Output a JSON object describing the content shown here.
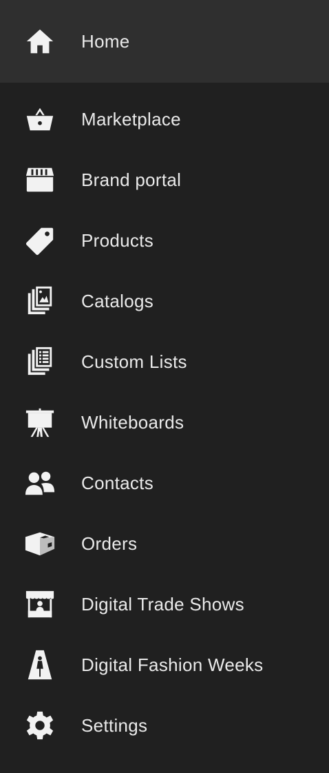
{
  "nav": {
    "items": [
      {
        "label": "Home",
        "icon": "home-icon",
        "active": true
      },
      {
        "label": "Marketplace",
        "icon": "basket-icon"
      },
      {
        "label": "Brand portal",
        "icon": "storefront-icon"
      },
      {
        "label": "Products",
        "icon": "tag-icon"
      },
      {
        "label": "Catalogs",
        "icon": "catalog-images-icon"
      },
      {
        "label": "Custom Lists",
        "icon": "list-document-icon"
      },
      {
        "label": "Whiteboards",
        "icon": "easel-board-icon"
      },
      {
        "label": "Contacts",
        "icon": "users-icon"
      },
      {
        "label": "Orders",
        "icon": "package-box-icon"
      },
      {
        "label": "Digital Trade Shows",
        "icon": "market-stand-icon"
      },
      {
        "label": "Digital Fashion Weeks",
        "icon": "runway-model-icon"
      },
      {
        "label": "Settings",
        "icon": "gear-icon"
      }
    ]
  },
  "colors": {
    "background": "#202020",
    "active_background": "#2f2f2f",
    "text": "#eaeaea",
    "icon": "#f2f2f2"
  }
}
